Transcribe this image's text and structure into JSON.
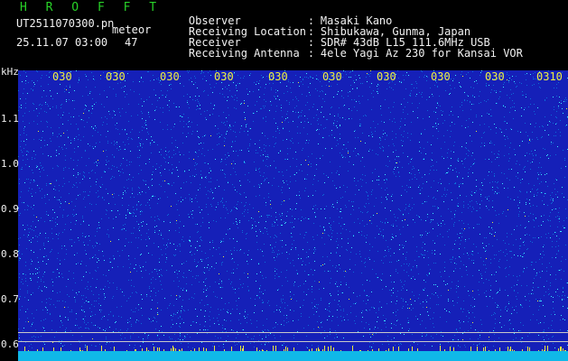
{
  "header": {
    "app_name": "H R O F F T",
    "filename": "UT2511070300.pn",
    "type_label": "meteor",
    "datetime": "25.11.07 03:00",
    "count": "47",
    "meta": [
      {
        "label": "Observer",
        "sep": ":",
        "value": "Masaki Kano"
      },
      {
        "label": "Receiving Location",
        "sep": ":",
        "value": "Shibukawa, Gunma, Japan"
      },
      {
        "label": "Receiver",
        "sep": ":",
        "value": "SDR# 43dB L15 111.6MHz USB"
      },
      {
        "label": "Receiving Antenna",
        "sep": ":",
        "value": "4ele Yagi Az 230 for Kansai VOR"
      }
    ]
  },
  "axis": {
    "unit": "kHz",
    "y_ticks": [
      "1.1",
      "1.0",
      "0.9",
      "0.8",
      "0.7",
      "0.6"
    ],
    "x_ticks": [
      "030",
      "030",
      "030",
      "030",
      "030",
      "030",
      "030",
      "030",
      "030",
      "0310"
    ]
  },
  "colors": {
    "background": "#1520b8",
    "noise_bright": "#3ee8ff",
    "noise_dim": "#0d6ad8",
    "noise_yellow": "#e8e840",
    "tick_text": "#f0f040",
    "app_name": "#28d228"
  }
}
